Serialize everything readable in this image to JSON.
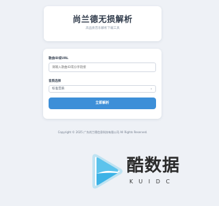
{
  "header": {
    "title": "尚兰德无损解析",
    "subtitle": "高品质音乐解析下载工具"
  },
  "form": {
    "url_label": "歌曲ID或URL",
    "url_placeholder": "请输入歌曲ID或分享链接",
    "quality_label": "音质选择",
    "quality_selected": "标准音质",
    "submit_label": "立即解析"
  },
  "footer": {
    "copyright": "Copyright © 2025 广东尚兰德信息科技有限公司 All Rights Reserved."
  },
  "watermark": {
    "name": "酷数据",
    "sub": "KUIDC"
  },
  "colors": {
    "accent": "#3d8fd8",
    "background": "#eef1f6",
    "card": "#ffffff"
  },
  "icons": {
    "select_chevron": "chevron-down-icon",
    "watermark_logo": "play-logo-icon"
  }
}
